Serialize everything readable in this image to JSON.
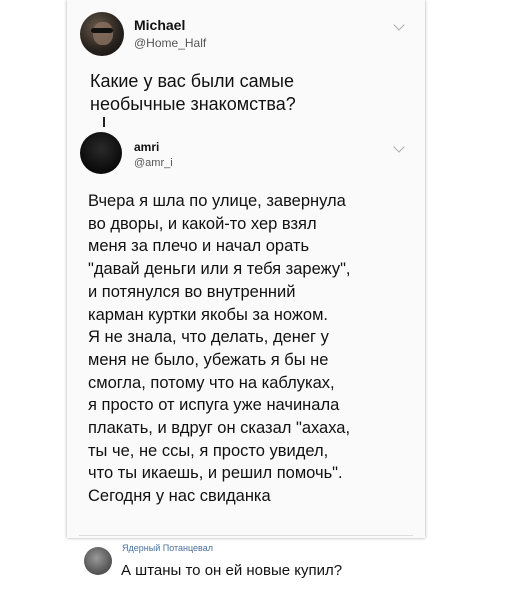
{
  "tweet1": {
    "name": "Michael",
    "handle": "@Home_Half",
    "text": "Какие у вас были самые\nнеобычные знакомства?"
  },
  "tweet2": {
    "name": "amri",
    "handle": "@amr_i",
    "text": "Вчера я шла по улице, завернула\nво дворы, и какой-то хер взял\nменя за плечо и начал орать\n\"давай деньги или я тебя зарежу\",\nи потянулся во внутренний\nкарман куртки якобы за ножом.\nЯ не знала, что делать, денег у\nменя не было, убежать я бы не\nсмогла, потому что на каблуках,\nя просто от испуга уже начинала\nплакать, и вдруг он сказал \"ахаха,\nты че, не ссы, я просто увидел,\nчто ты икаешь, и решил помочь\".\nСегодня у нас свиданка"
  },
  "comment": {
    "author": "Ядерный Потанцевал",
    "text": "А штаны то он ей новые купил?"
  }
}
